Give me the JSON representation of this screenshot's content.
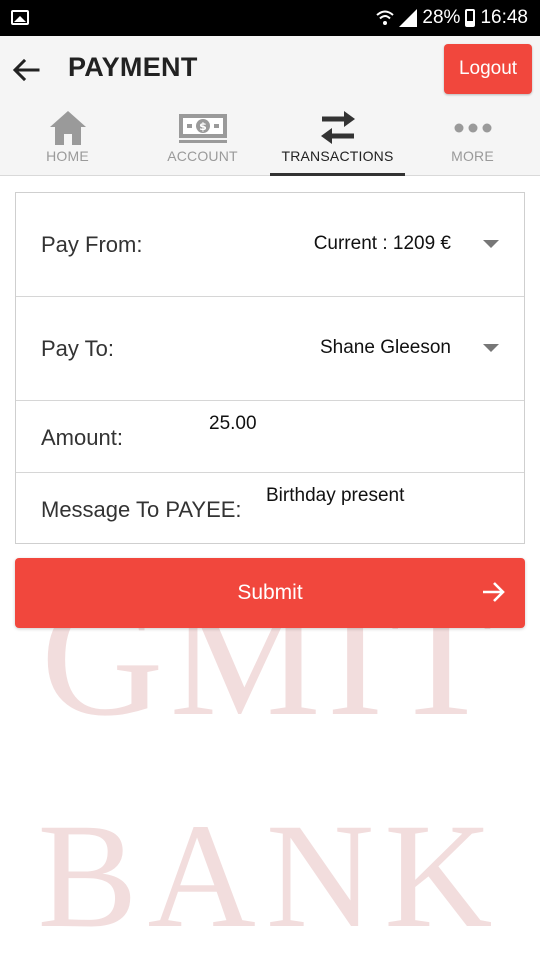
{
  "status_bar": {
    "battery": "28%",
    "time": "16:48"
  },
  "header": {
    "title": "PAYMENT",
    "logout_label": "Logout"
  },
  "tabs": [
    {
      "label": "HOME",
      "icon": "home-icon",
      "active": false
    },
    {
      "label": "ACCOUNT",
      "icon": "money-icon",
      "active": false
    },
    {
      "label": "TRANSACTIONS",
      "icon": "transfer-arrows-icon",
      "active": true
    },
    {
      "label": "MORE",
      "icon": "more-dots-icon",
      "active": false
    }
  ],
  "form": {
    "pay_from": {
      "label": "Pay From:",
      "value": "Current : 1209 €"
    },
    "pay_to": {
      "label": "Pay To:",
      "value": "Shane Gleeson"
    },
    "amount": {
      "label": "Amount:",
      "value": "25.00"
    },
    "message": {
      "label": "Message To PAYEE:",
      "value": "Birthday present"
    }
  },
  "submit": {
    "label": "Submit"
  },
  "watermark": {
    "line1": "GMIT",
    "line2": "BANK"
  },
  "colors": {
    "accent": "#f1473d",
    "tab_inactive": "#9a9a9a",
    "watermark": "#f2dddd"
  }
}
